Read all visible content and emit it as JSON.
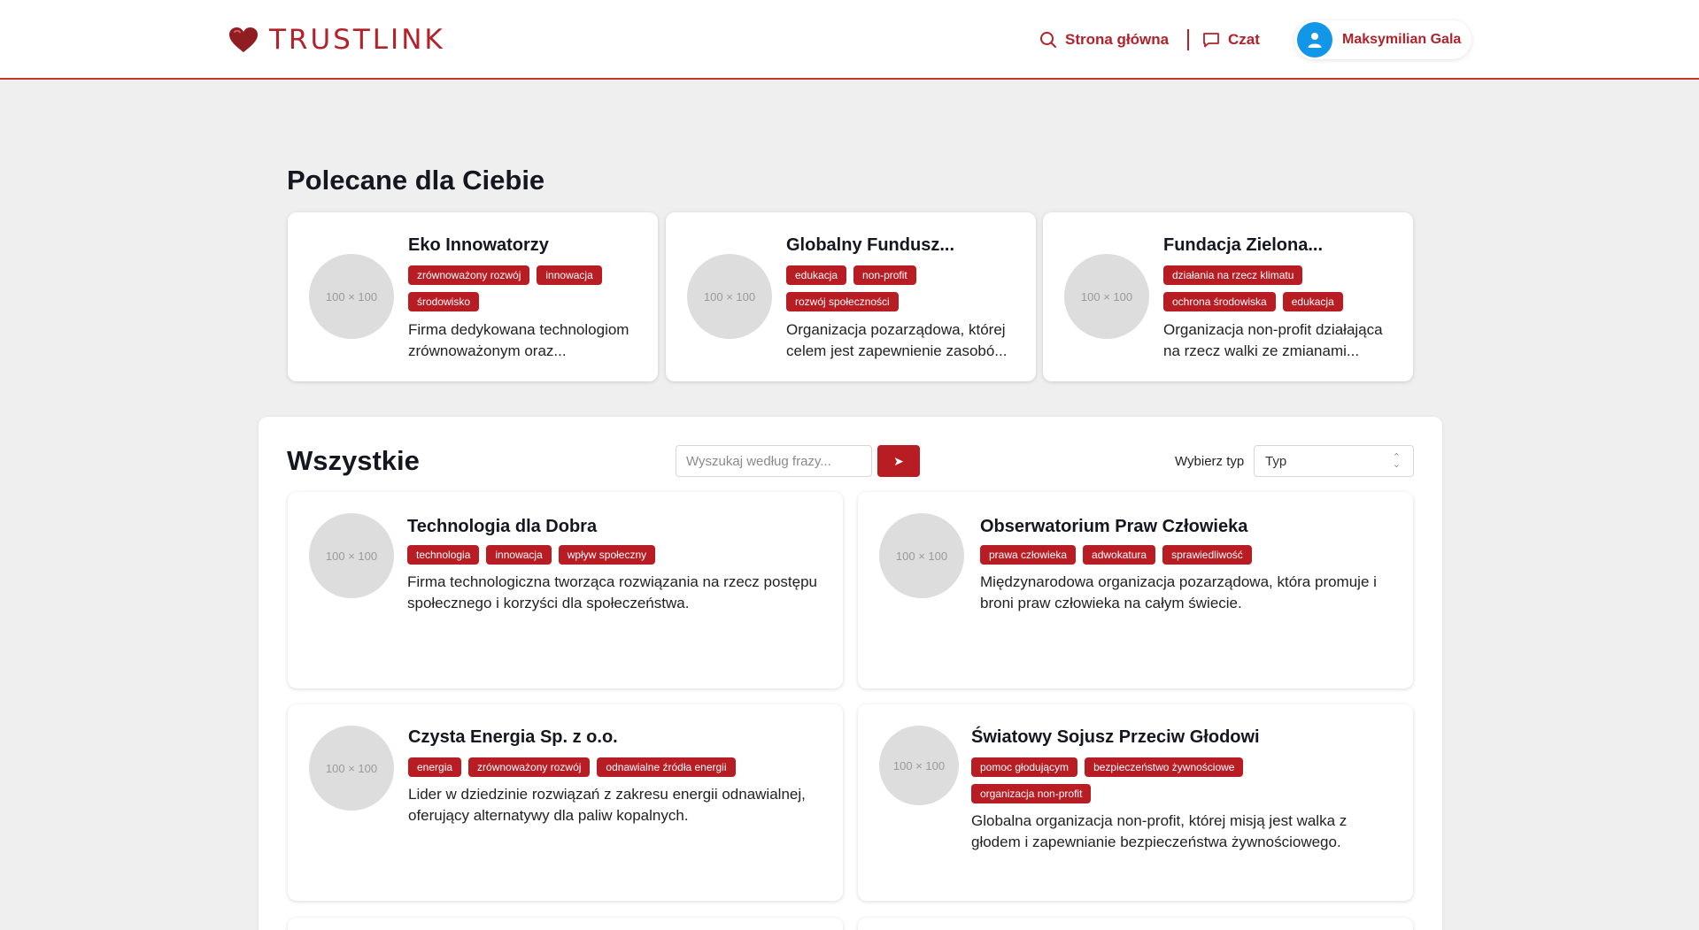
{
  "header": {
    "logo_text": "TRUSTLINK",
    "nav_home": "Strona główna",
    "nav_chat": "Czat",
    "user_name": "Maksymilian Gala"
  },
  "recommended": {
    "title": "Polecane dla Ciebie",
    "cards": [
      {
        "thumb": "100 × 100",
        "name": "Eko Innowatorzy",
        "tags": [
          "zrównoważony rozwój",
          "innowacja",
          "środowisko"
        ],
        "description_line1": "Firma dedykowana technologiom",
        "description_line2": "zrównoważonym oraz..."
      },
      {
        "thumb": "100 × 100",
        "name": "Globalny Fundusz...",
        "tags": [
          "edukacja",
          "non-profit",
          "rozwój społeczności"
        ],
        "description_line1": "Organizacja pozarządowa, której",
        "description_line2": "celem jest zapewnienie zasobó..."
      },
      {
        "thumb": "100 × 100",
        "name": "Fundacja Zielona...",
        "tags": [
          "działania na rzecz klimatu",
          "ochrona środowiska",
          "edukacja"
        ],
        "description_line1": "Organizacja non-profit działająca",
        "description_line2": "na rzecz walki ze zmianami..."
      }
    ]
  },
  "all": {
    "title": "Wszystkie",
    "search_placeholder": "Wyszukaj według frazy...",
    "search_button": "➤",
    "type_label": "Wybierz typ",
    "type_selected": "Typ",
    "cards": [
      {
        "thumb": "100 × 100",
        "name": "Technologia dla Dobra",
        "tags": [
          "technologia",
          "innowacja",
          "wpływ społeczny"
        ],
        "description_line1": "Firma technologiczna tworząca rozwiązania na rzecz postępu",
        "description_line2": "społecznego i korzyści dla społeczeństwa."
      },
      {
        "thumb": "100 × 100",
        "name": "Obserwatorium Praw Człowieka",
        "tags": [
          "prawa człowieka",
          "adwokatura",
          "sprawiedliwość"
        ],
        "description_line1": "Międzynarodowa organizacja pozarządowa, która promuje i",
        "description_line2": "broni praw człowieka na całym świecie."
      },
      {
        "thumb": "100 × 100",
        "name": "Czysta Energia Sp. z o.o.",
        "tags": [
          "energia",
          "zrównoważony rozwój",
          "odnawialne źródła energii"
        ],
        "description_line1": "Lider w dziedzinie rozwiązań z zakresu energii odnawialnej,",
        "description_line2": "oferujący alternatywy dla paliw kopalnych."
      },
      {
        "thumb": "100 × 100",
        "name": "Światowy Sojusz Przeciw Głodowi",
        "tags": [
          "pomoc głodującym",
          "bezpieczeństwo żywnościowe",
          "organizacja non-profit"
        ],
        "description_line1": "Globalna organizacja non-profit, której misją jest walka z",
        "description_line2": "głodem i zapewnianie bezpieczeństwa żywnościowego."
      }
    ]
  }
}
